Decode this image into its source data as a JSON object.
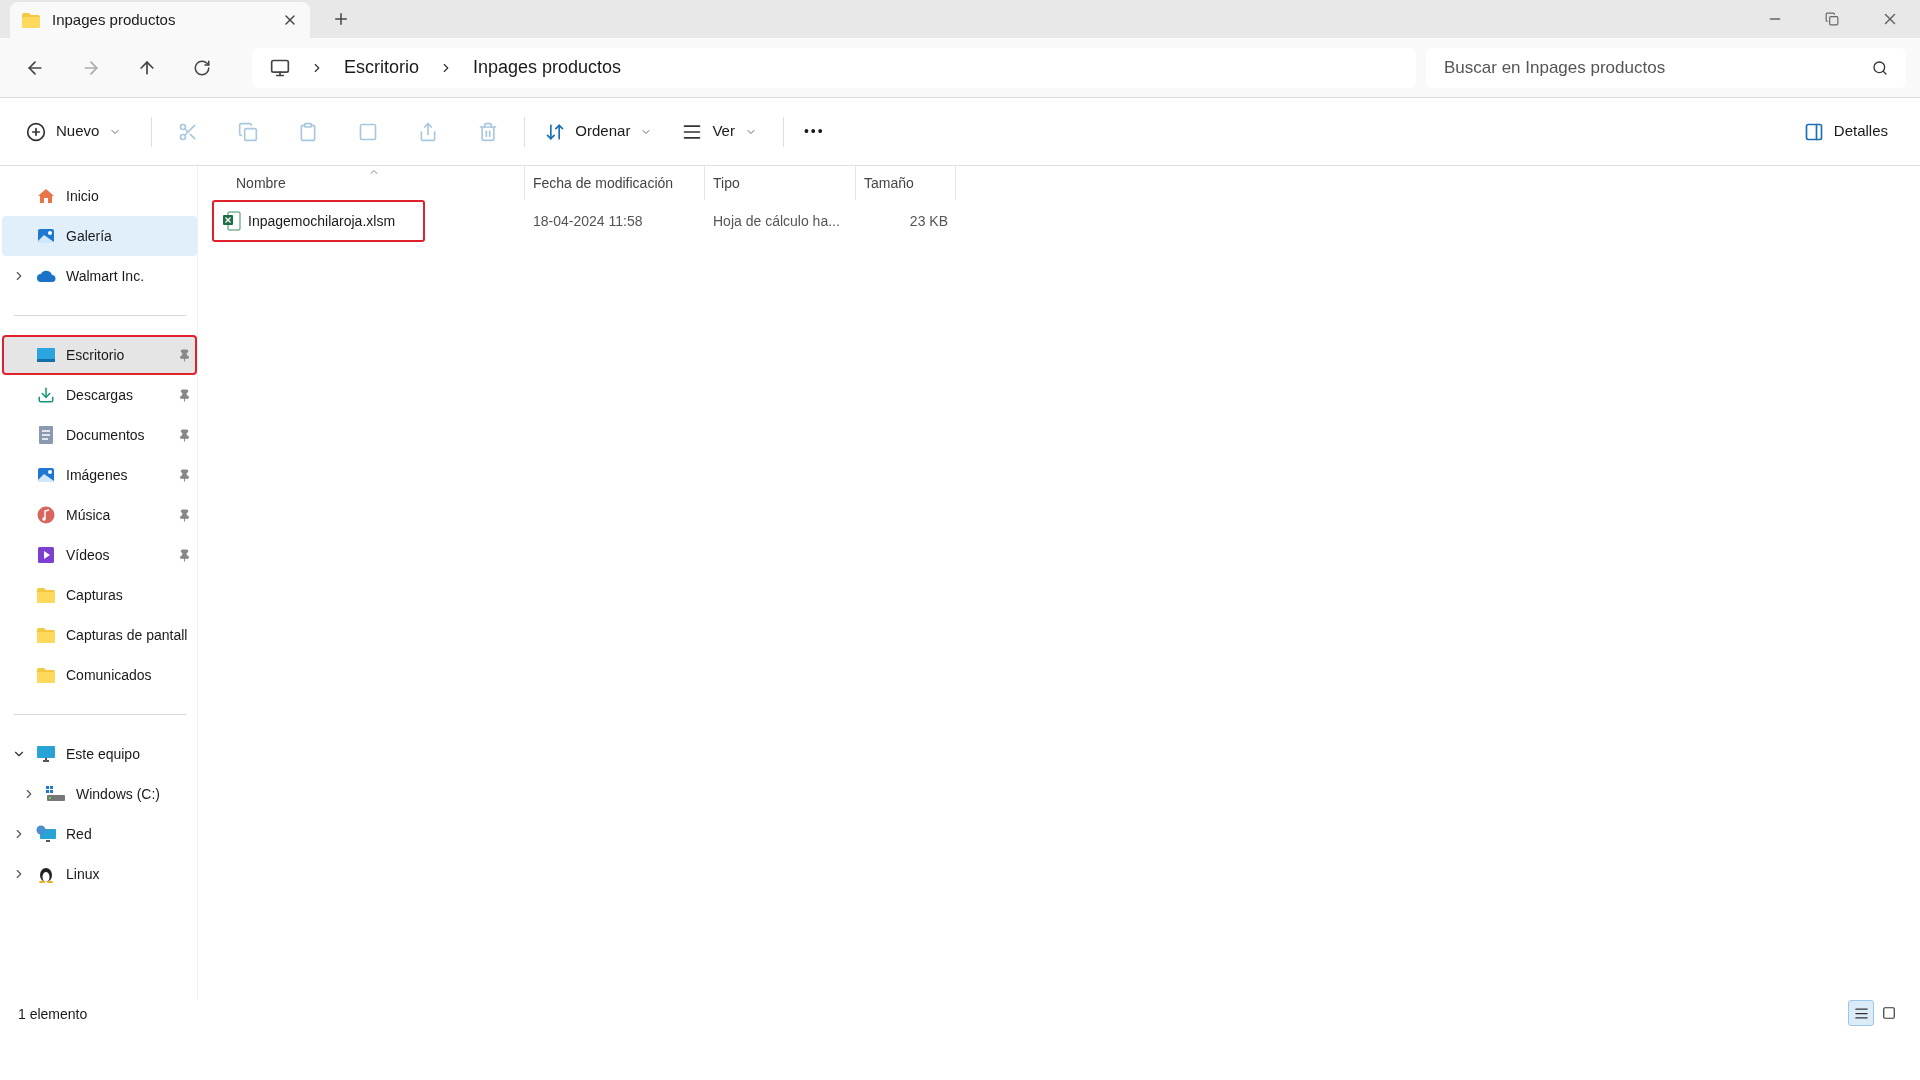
{
  "tab": {
    "title": "Inpages productos"
  },
  "breadcrumb": [
    "Escritorio",
    "Inpages productos"
  ],
  "search": {
    "placeholder": "Buscar en Inpages productos"
  },
  "toolbar": {
    "new_label": "Nuevo",
    "sort_label": "Ordenar",
    "view_label": "Ver",
    "more": "•••",
    "details_label": "Detalles"
  },
  "sidebar": {
    "sections": [
      [
        {
          "label": "Inicio",
          "kind": "home",
          "pinned": false,
          "selected": false,
          "hovered": false,
          "annotated": false
        },
        {
          "label": "Galería",
          "kind": "gallery",
          "pinned": false,
          "selected": true,
          "hovered": false,
          "annotated": false
        },
        {
          "label": "Walmart Inc.",
          "kind": "cloud",
          "expanded": false,
          "pinned": false,
          "selected": false,
          "hovered": false,
          "annotated": false
        }
      ],
      [
        {
          "label": "Escritorio",
          "kind": "desktop",
          "pinned": true,
          "selected": false,
          "hovered": true,
          "annotated": true
        },
        {
          "label": "Descargas",
          "kind": "download",
          "pinned": true,
          "selected": false,
          "hovered": false,
          "annotated": false
        },
        {
          "label": "Documentos",
          "kind": "document",
          "pinned": true,
          "selected": false,
          "hovered": false,
          "annotated": false
        },
        {
          "label": "Imágenes",
          "kind": "gallery",
          "pinned": true,
          "selected": false,
          "hovered": false,
          "annotated": false
        },
        {
          "label": "Música",
          "kind": "music",
          "pinned": true,
          "selected": false,
          "hovered": false,
          "annotated": false
        },
        {
          "label": "Vídeos",
          "kind": "video",
          "pinned": true,
          "selected": false,
          "hovered": false,
          "annotated": false
        },
        {
          "label": "Capturas",
          "kind": "folder",
          "pinned": false,
          "selected": false,
          "hovered": false,
          "annotated": false
        },
        {
          "label": "Capturas de pantall",
          "kind": "folder",
          "pinned": false,
          "selected": false,
          "hovered": false,
          "annotated": false
        },
        {
          "label": "Comunicados",
          "kind": "folder",
          "pinned": false,
          "selected": false,
          "hovered": false,
          "annotated": false
        }
      ],
      [
        {
          "label": "Este equipo",
          "kind": "pc",
          "expanded": true,
          "pinned": false,
          "selected": false,
          "hovered": false,
          "annotated": false,
          "children": [
            {
              "label": "Windows (C:)",
              "kind": "drive",
              "expanded": false,
              "pinned": false,
              "selected": false,
              "hovered": false,
              "annotated": false
            }
          ]
        },
        {
          "label": "Red",
          "kind": "network",
          "expanded": false,
          "pinned": false,
          "selected": false,
          "hovered": false,
          "annotated": false
        },
        {
          "label": "Linux",
          "kind": "linux",
          "expanded": false,
          "pinned": false,
          "selected": false,
          "hovered": false,
          "annotated": false
        }
      ]
    ]
  },
  "table": {
    "columns": [
      {
        "label": "Nombre",
        "sorted": true
      },
      {
        "label": "Fecha de modificación",
        "sorted": false
      },
      {
        "label": "Tipo",
        "sorted": false
      },
      {
        "label": "Tamaño",
        "sorted": false
      }
    ],
    "rows": [
      {
        "name": "Inpagemochilaroja.xlsm",
        "modified": "18-04-2024 11:58",
        "type": "Hoja de cálculo ha...",
        "size": "23 KB",
        "annotated": true
      }
    ]
  },
  "status_bar": {
    "count": "1 elemento",
    "view_buttons": [
      {
        "kind": "details",
        "selected": true
      },
      {
        "kind": "tiles",
        "selected": false
      }
    ]
  }
}
